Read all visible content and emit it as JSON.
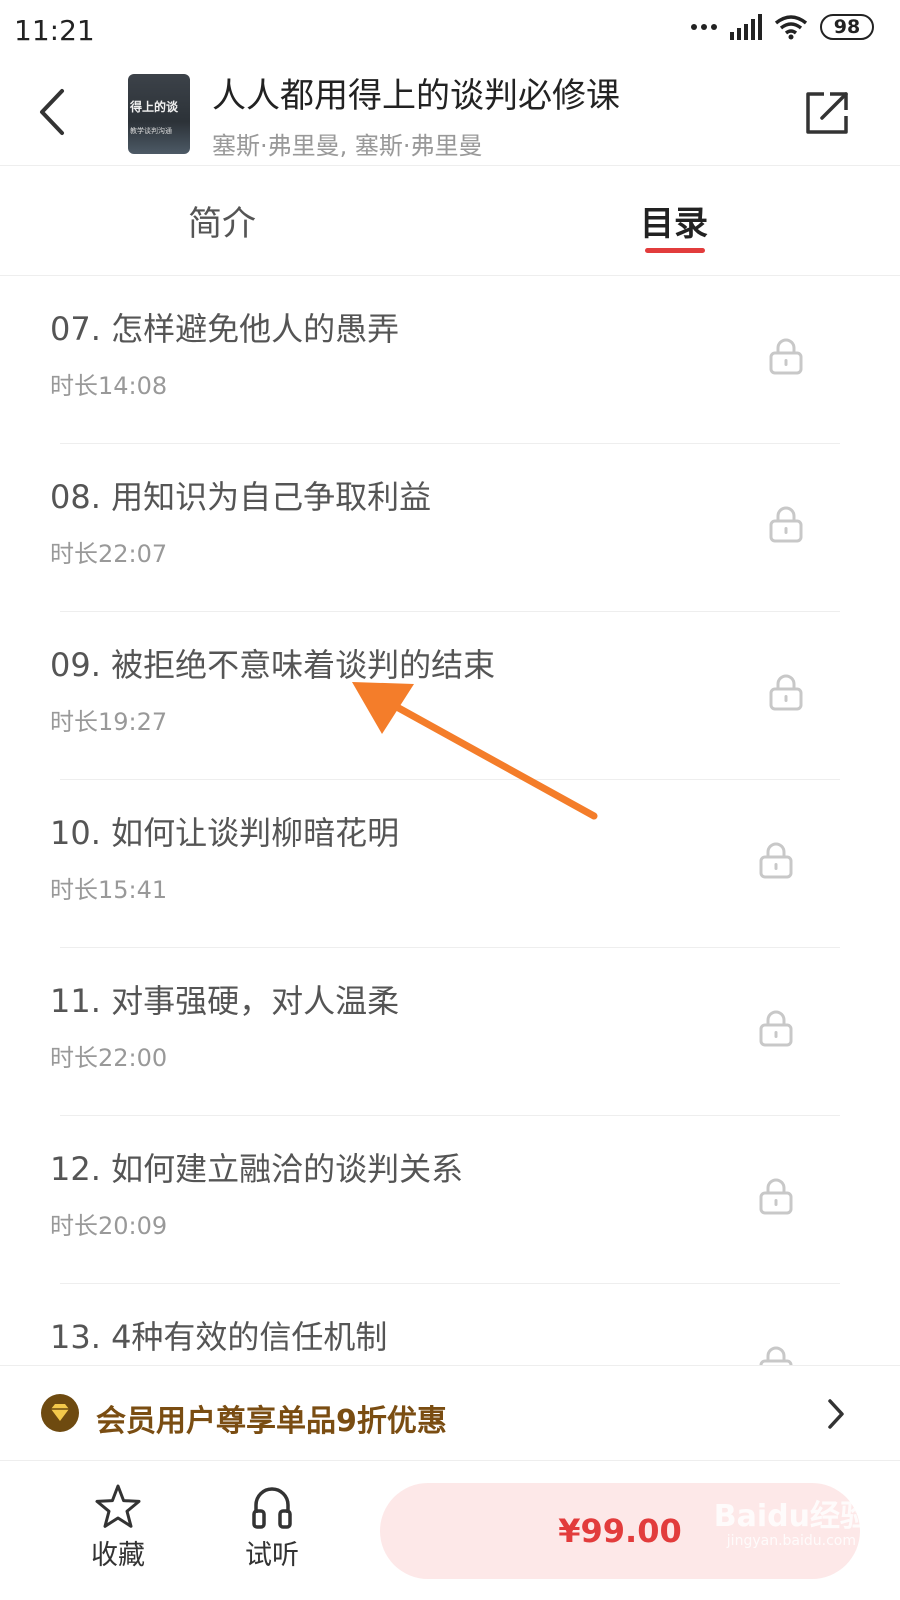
{
  "status_bar": {
    "time": "11:21",
    "battery": "98"
  },
  "header": {
    "cover_line1": "得上的谈",
    "cover_line2": "教学谈判沟通",
    "title": "人人都用得上的谈判必修课",
    "author": "塞斯·弗里曼, 塞斯·弗里曼"
  },
  "tabs": [
    {
      "label": "简介",
      "active": false
    },
    {
      "label": "目录",
      "active": true
    }
  ],
  "accent_color": "#e23c3c",
  "chapters": [
    {
      "title": "07. 怎样避免他人的愚弄",
      "duration": "时长14:08",
      "locked": true
    },
    {
      "title": "08. 用知识为自己争取利益",
      "duration": "时长22:07",
      "locked": true
    },
    {
      "title": "09. 被拒绝不意味着谈判的结束",
      "duration": "时长19:27",
      "locked": true
    },
    {
      "title": "10. 如何让谈判柳暗花明",
      "duration": "时长15:41",
      "locked": true
    },
    {
      "title": "11. 对事强硬，对人温柔",
      "duration": "时长22:00",
      "locked": true
    },
    {
      "title": "12. 如何建立融洽的谈判关系",
      "duration": "时长20:09",
      "locked": true
    },
    {
      "title": "13. 4种有效的信任机制",
      "duration": "",
      "locked": true
    }
  ],
  "vip_banner": {
    "text": "会员用户尊享单品9折优惠"
  },
  "bottom_bar": {
    "favorite_label": "收藏",
    "trial_label": "试听",
    "price": "¥99.00"
  },
  "watermark": {
    "main": "Baidu经验",
    "sub": "jingyan.baidu.com"
  }
}
